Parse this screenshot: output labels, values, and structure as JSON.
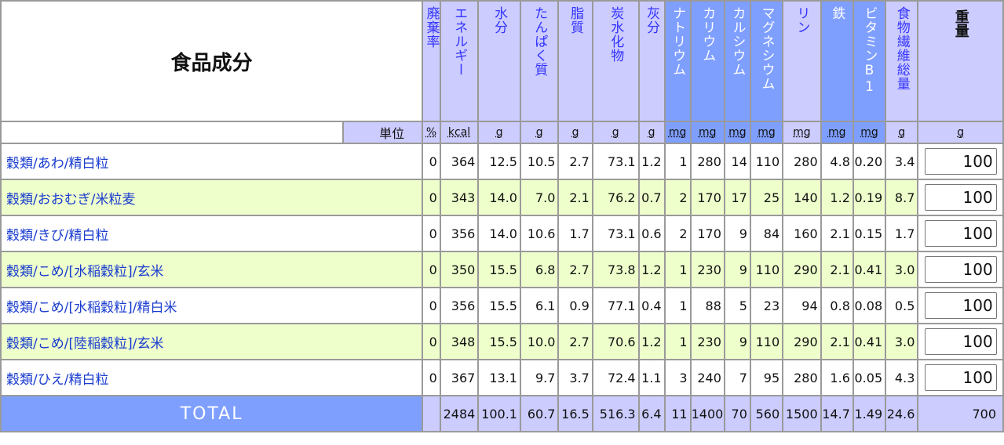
{
  "title": "食品成分",
  "unit_label": "単位",
  "weight_header": "重量",
  "weight_unit": "g",
  "colors": {
    "lavender": "#ccccff",
    "blue": "#7f9fff",
    "row_alt": "#eeffcc",
    "link": "#1a3ccf"
  },
  "columns": [
    {
      "label": "廃棄率",
      "unit": "%"
    },
    {
      "label": "エネルギー",
      "unit": "kcal"
    },
    {
      "label": "水分",
      "unit": "g"
    },
    {
      "label": "たんぱく質",
      "unit": "g"
    },
    {
      "label": "脂質",
      "unit": "g"
    },
    {
      "label": "炭水化物",
      "unit": "g"
    },
    {
      "label": "灰分",
      "unit": "g"
    },
    {
      "label": "ナトリウム",
      "unit": "mg"
    },
    {
      "label": "カリウム",
      "unit": "mg"
    },
    {
      "label": "カルシウム",
      "unit": "mg"
    },
    {
      "label": "マグネシウム",
      "unit": "mg"
    },
    {
      "label": "リン",
      "unit": "mg"
    },
    {
      "label": "鉄",
      "unit": "mg"
    },
    {
      "label": "ビタミンB1",
      "unit": "mg"
    },
    {
      "label": "食物繊維総量",
      "unit": "g"
    }
  ],
  "rows": [
    {
      "name": "穀類/あわ/精白粒",
      "values": [
        "0",
        "364",
        "12.5",
        "10.5",
        "2.7",
        "73.1",
        "1.2",
        "1",
        "280",
        "14",
        "110",
        "280",
        "4.8",
        "0.20",
        "3.4"
      ],
      "weight": "100"
    },
    {
      "name": "穀類/おおむぎ/米粒麦",
      "values": [
        "0",
        "343",
        "14.0",
        "7.0",
        "2.1",
        "76.2",
        "0.7",
        "2",
        "170",
        "17",
        "25",
        "140",
        "1.2",
        "0.19",
        "8.7"
      ],
      "weight": "100"
    },
    {
      "name": "穀類/きび/精白粒",
      "values": [
        "0",
        "356",
        "14.0",
        "10.6",
        "1.7",
        "73.1",
        "0.6",
        "2",
        "170",
        "9",
        "84",
        "160",
        "2.1",
        "0.15",
        "1.7"
      ],
      "weight": "100"
    },
    {
      "name": "穀類/こめ/[水稲穀粒]/玄米",
      "values": [
        "0",
        "350",
        "15.5",
        "6.8",
        "2.7",
        "73.8",
        "1.2",
        "1",
        "230",
        "9",
        "110",
        "290",
        "2.1",
        "0.41",
        "3.0"
      ],
      "weight": "100"
    },
    {
      "name": "穀類/こめ/[水稲穀粒]/精白米",
      "values": [
        "0",
        "356",
        "15.5",
        "6.1",
        "0.9",
        "77.1",
        "0.4",
        "1",
        "88",
        "5",
        "23",
        "94",
        "0.8",
        "0.08",
        "0.5"
      ],
      "weight": "100"
    },
    {
      "name": "穀類/こめ/[陸稲穀粒]/玄米",
      "values": [
        "0",
        "348",
        "15.5",
        "10.0",
        "2.7",
        "70.6",
        "1.2",
        "1",
        "230",
        "9",
        "110",
        "290",
        "2.1",
        "0.41",
        "3.0"
      ],
      "weight": "100"
    },
    {
      "name": "穀類/ひえ/精白粒",
      "values": [
        "0",
        "367",
        "13.1",
        "9.7",
        "3.7",
        "72.4",
        "1.1",
        "3",
        "240",
        "7",
        "95",
        "280",
        "1.6",
        "0.05",
        "4.3"
      ],
      "weight": "100"
    }
  ],
  "total": {
    "label": "TOTAL",
    "values": [
      "",
      "2484",
      "100.1",
      "60.7",
      "16.5",
      "516.3",
      "6.4",
      "11",
      "1400",
      "70",
      "560",
      "1500",
      "14.7",
      "1.49",
      "24.6"
    ],
    "weight": "700"
  }
}
